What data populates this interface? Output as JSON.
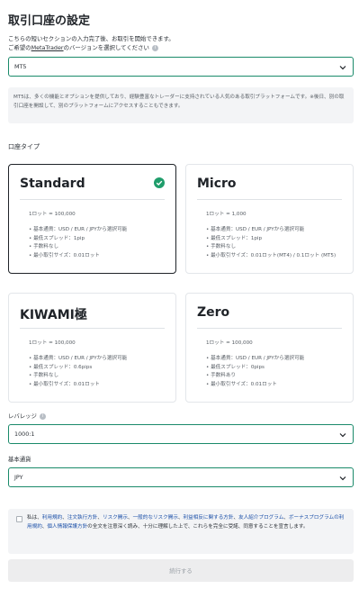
{
  "title": "取引口座の設定",
  "intro": {
    "line1": "こちらの短いセクションの入力完了後、お取引を開始できます。",
    "line2_prefix": "ご希望の",
    "line2_link": "MetaTrader",
    "line2_suffix": "のバージョンを選択してください"
  },
  "platform": {
    "value": "MT5",
    "description": "MT5は、多くの機能とオプションを提供しており、経験豊富なトレーダーに支持されている人気のある取引プラットフォームです。※後日、別の取引口座を開設して、別のプラットフォームにアクセスすることもできます。"
  },
  "account_type": {
    "label": "口座タイプ",
    "cards": [
      {
        "name": "Standard",
        "lot": "1ロット = 100,000",
        "features": [
          "• 基本通貨：USD / EUR / JPYから選択可能",
          "• 最低スプレッド：1pip",
          "• 手数料なし",
          "• 最小取引サイズ：0.01ロット"
        ],
        "selected": true
      },
      {
        "name": "Micro",
        "lot": "1ロット = 1,000",
        "features": [
          "• 基本通貨：USD / EUR / JPYから選択可能",
          "• 最低スプレッド：1pip",
          "• 手数料なし",
          "• 最小取引サイズ：0.01ロット(MT4) / 0.1ロット (MT5)"
        ],
        "selected": false
      },
      {
        "name": "KIWAMI極",
        "lot": "1ロット = 100,000",
        "features": [
          "• 基本通貨：USD / EUR / JPYから選択可能",
          "• 最低スプレッド：0.6pips",
          "• 手数料なし",
          "• 最小取引サイズ：0.01ロット"
        ],
        "selected": false
      },
      {
        "name": "Zero",
        "lot": "1ロット = 100,000",
        "features": [
          "• 基本通貨：USD / EUR / JPYから選択可能",
          "• 最低スプレッド：0pips",
          "• 手数料あり",
          "• 最小取引サイズ：0.01ロット"
        ],
        "selected": false
      }
    ]
  },
  "leverage": {
    "label": "レバレッジ",
    "value": "1000:1"
  },
  "currency": {
    "label": "基本通貨",
    "value": "JPY"
  },
  "terms": {
    "t1": "私は、",
    "l1": "利用規約",
    "t2": "、",
    "l2": "注文執行方針",
    "t3": "、",
    "l3": "リスク開示",
    "t4": "、",
    "l4": "一般的なリスク開示",
    "t5": "、",
    "l5": "利益相反に関する方針",
    "t6": "、",
    "l6": "友人紹介プログラム",
    "t7": "、",
    "l7": "ボーナスプログラムの利用規約",
    "t8": "、",
    "l8": "個人情報保護方針",
    "t9": "の全文を注意深く読み、十分に理解した上で、これらを完全に受諾、同意することを宣言します。"
  },
  "continue_label": "続行する",
  "colors": {
    "accent": "#1a8a6a",
    "check": "#1f9d6b",
    "link": "#1b4fa8"
  }
}
